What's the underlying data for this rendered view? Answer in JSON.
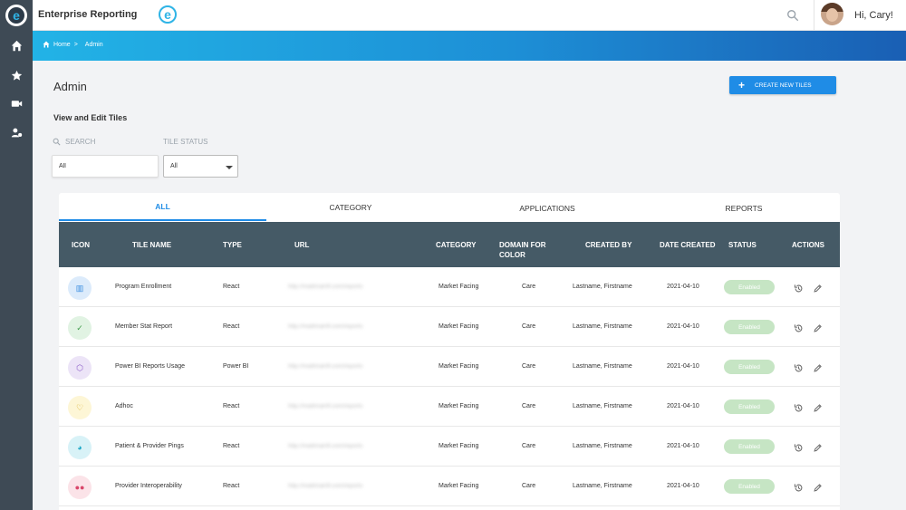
{
  "app": {
    "title": "Enterprise Reporting",
    "brand_mark": "e"
  },
  "user": {
    "greeting": "Hi, Cary!"
  },
  "rail": {
    "items": [
      "home-icon",
      "star-icon",
      "video-icon",
      "user-settings-icon"
    ]
  },
  "breadcrumb": {
    "home": "Home",
    "separator": ">",
    "current": "Admin"
  },
  "page": {
    "title": "Admin",
    "section_title": "View and Edit Tiles"
  },
  "toolbar": {
    "create_label": "CREATE NEW TILES"
  },
  "filters": {
    "search_label": "SEARCH",
    "search_value": "All",
    "status_label": "TILE STATUS",
    "status_value": "All"
  },
  "tabs": [
    "ALL",
    "CATEGORY",
    "APPLICATIONS",
    "REPORTS"
  ],
  "columns": {
    "icon": "ICON",
    "tile_name": "TILE NAME",
    "type": "TYPE",
    "url": "URL",
    "category": "CATEGORY",
    "domain": "DOMAIN FOR COLOR",
    "created_by": "CREATED BY",
    "date_created": "DATE CREATED",
    "status": "STATUS",
    "actions": "ACTIONS"
  },
  "rows": [
    {
      "icon": "chart-icon",
      "icon_glyph": "▥",
      "icon_bg": "#dcebfb",
      "icon_fg": "#3b8ee0",
      "name": "Program Enrollment",
      "type": "React",
      "url": "http://mattmainfl.com/reports",
      "category": "Market Facing",
      "domain": "Care",
      "created_by": "Lastname, Firstname",
      "date": "2021-04-10",
      "status": "Enabled"
    },
    {
      "icon": "check-icon",
      "icon_glyph": "✓",
      "icon_bg": "#e1f3e3",
      "icon_fg": "#3e9b4a",
      "name": "Member Stat Report",
      "type": "React",
      "url": "http://mattmainfl.com/reports",
      "category": "Market Facing",
      "domain": "Care",
      "created_by": "Lastname, Firstname",
      "date": "2021-04-10",
      "status": "Enabled"
    },
    {
      "icon": "cube-icon",
      "icon_glyph": "⬡",
      "icon_bg": "#ece4f7",
      "icon_fg": "#8a5cc8",
      "name": "Power BI Reports Usage",
      "type": "Power BI",
      "url": "http://mattmainfl.com/reports",
      "category": "Market Facing",
      "domain": "Care",
      "created_by": "Lastname, Firstname",
      "date": "2021-04-10",
      "status": "Enabled"
    },
    {
      "icon": "stethoscope-icon",
      "icon_glyph": "♡",
      "icon_bg": "#fdf6d6",
      "icon_fg": "#d4a514",
      "name": "Adhoc",
      "type": "React",
      "url": "http://mattmainfl.com/reports",
      "category": "Market Facing",
      "domain": "Care",
      "created_by": "Lastname, Firstname",
      "date": "2021-04-10",
      "status": "Enabled"
    },
    {
      "icon": "pie-chart-icon",
      "icon_glyph": "◕",
      "icon_bg": "#d8f2f7",
      "icon_fg": "#1fa9c7",
      "name": "Patient & Provider Pings",
      "type": "React",
      "url": "http://mattmainfl.com/reports",
      "category": "Market Facing",
      "domain": "Care",
      "created_by": "Lastname, Firstname",
      "date": "2021-04-10",
      "status": "Enabled"
    },
    {
      "icon": "group-icon",
      "icon_glyph": "●●",
      "icon_bg": "#fbe3e8",
      "icon_fg": "#d9466a",
      "name": "Provider Interoperability",
      "type": "React",
      "url": "http://mattmainfl.com/reports",
      "category": "Market Facing",
      "domain": "Care",
      "created_by": "Lastname, Firstname",
      "date": "2021-04-10",
      "status": "Enabled"
    }
  ]
}
